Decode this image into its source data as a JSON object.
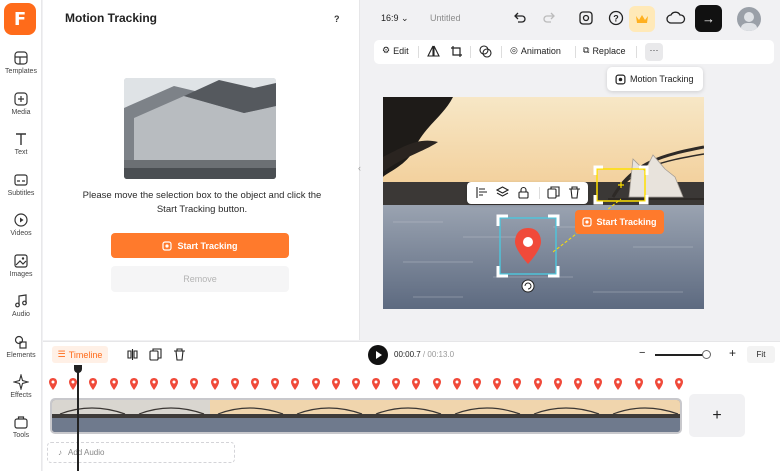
{
  "app": {
    "logo_letter": "F",
    "accent": "#ff7a2c"
  },
  "sidebar": {
    "items": [
      {
        "label": "Templates",
        "icon": "templates-icon"
      },
      {
        "label": "Media",
        "icon": "media-icon"
      },
      {
        "label": "Text",
        "icon": "text-icon"
      },
      {
        "label": "Subtitles",
        "icon": "subtitles-icon"
      },
      {
        "label": "Videos",
        "icon": "videos-icon"
      },
      {
        "label": "Images",
        "icon": "images-icon"
      },
      {
        "label": "Audio",
        "icon": "audio-icon"
      },
      {
        "label": "Elements",
        "icon": "elements-icon"
      },
      {
        "label": "Effects",
        "icon": "effects-icon"
      },
      {
        "label": "Tools",
        "icon": "tools-icon"
      }
    ]
  },
  "panel": {
    "title": "Motion Tracking",
    "help": "?",
    "instruction": "Please move the selection box to the object and click the Start Tracking button.",
    "start_label": "Start Tracking",
    "remove_label": "Remove"
  },
  "header": {
    "ratio": "16:9",
    "project_name": "Untitled",
    "export_icon": "arrow-right-icon"
  },
  "toolbar": {
    "edit": "Edit",
    "animation": "Animation",
    "replace": "Replace",
    "more": "···"
  },
  "dropdown": {
    "motion_tracking": "Motion Tracking"
  },
  "canvas": {
    "start_tracking": "Start Tracking"
  },
  "timeline": {
    "tab": "Timeline",
    "current_time": "00:00.7",
    "separator": " / ",
    "duration": "00:13.0",
    "fit": "Fit",
    "zoom_level": 0.85,
    "add_audio": "Add Audio",
    "add_clip": "+",
    "marker_count": 32
  }
}
